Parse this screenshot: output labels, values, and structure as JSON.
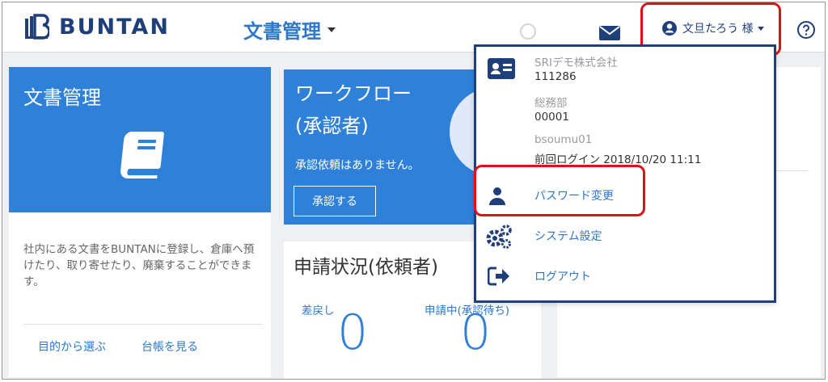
{
  "header": {
    "logo_text": "BUNTAN",
    "app_title": "文書管理",
    "user_name": "文旦たろう 様"
  },
  "docs_card": {
    "title": "文書管理",
    "description": "社内にある文書をBUNTANに登録し、倉庫へ預けたり、取り寄せたり、廃棄することができます。",
    "link_purpose": "目的から選ぶ",
    "link_ledger": "台帳を見る"
  },
  "workflow_card": {
    "title_line1": "ワークフロー",
    "title_line2": "(承認者)",
    "message": "承認依頼はありません。",
    "approve_button": "承認する"
  },
  "status_card": {
    "title": "申請状況(依頼者)",
    "returned_label": "差戻し",
    "returned_count": "0",
    "pending_label": "申請中(承認待ち)",
    "pending_count": "0"
  },
  "user_dropdown": {
    "company": "SRIデモ株式会社",
    "company_code": "111286",
    "department": "総務部",
    "department_code": "00001",
    "user_id": "bsoumu01",
    "last_login": "前回ログイン 2018/10/20 11:11",
    "menu": {
      "password_change": "パスワード変更",
      "system_settings": "システム設定",
      "logout": "ログアウト"
    }
  },
  "colors": {
    "primary_blue": "#2f80d9",
    "navy": "#1f3f7a",
    "highlight_red": "#e0101a"
  }
}
